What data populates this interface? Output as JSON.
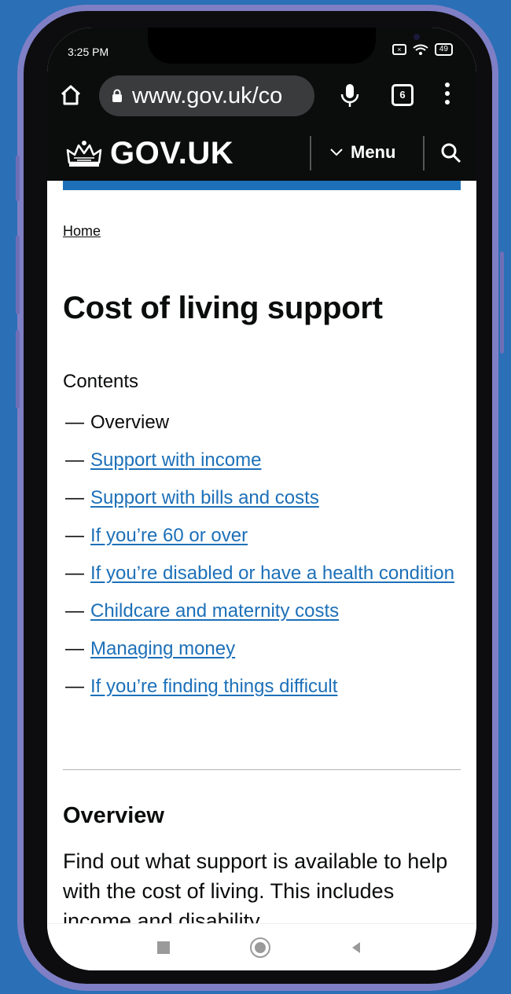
{
  "status_bar": {
    "time": "3:25 PM",
    "battery": "49"
  },
  "browser": {
    "url": "www.gov.uk/co",
    "tab_count": "6"
  },
  "gov_header": {
    "logo_text": "GOV.UK",
    "menu_label": "Menu"
  },
  "breadcrumb": {
    "home_label": "Home"
  },
  "page": {
    "title": "Cost of living support",
    "contents_label": "Contents",
    "contents": [
      {
        "label": "Overview",
        "current": true
      },
      {
        "label": "Support with income",
        "current": false
      },
      {
        "label": "Support with bills and costs",
        "current": false
      },
      {
        "label": "If you’re 60 or over",
        "current": false
      },
      {
        "label": "If you’re disabled or have a health condition",
        "current": false
      },
      {
        "label": "Childcare and maternity costs",
        "current": false
      },
      {
        "label": "Managing money",
        "current": false
      },
      {
        "label": "If you’re finding things difficult",
        "current": false
      }
    ],
    "overview_heading": "Overview",
    "overview_text": "Find out what support is available to help with the cost of living. This includes income and disability"
  },
  "colors": {
    "background": "#2b6fb6",
    "govuk_black": "#0b0c0c",
    "govuk_blue": "#1d70b8",
    "link": "#1d70b8"
  }
}
